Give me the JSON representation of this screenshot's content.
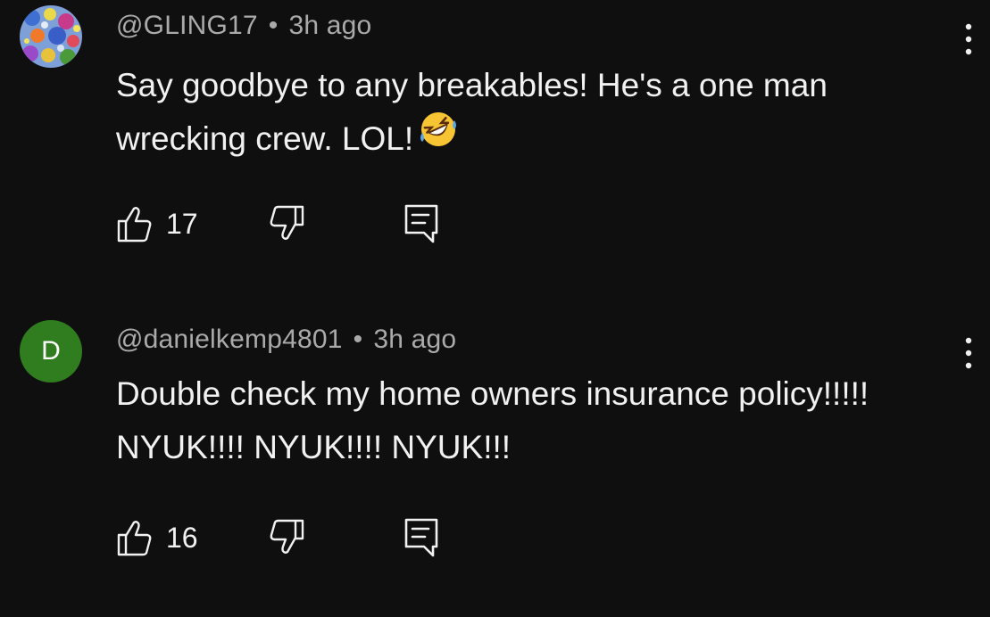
{
  "comments": [
    {
      "author": "@GLING17",
      "separator": "•",
      "time": "3h ago",
      "text": "Say goodbye to any breakables! He's a one man wrecking crew. LOL!",
      "emoji": "rolling-on-the-floor-laughing",
      "likes": "17",
      "avatar": "flower-photo"
    },
    {
      "author": "@danielkemp4801",
      "separator": "•",
      "time": "3h ago",
      "text": "Double check my home owners insurance policy!!!!! NYUK!!!! NYUK!!!! NYUK!!!",
      "likes": "16",
      "avatar_letter": "D",
      "avatar_color": "#2f7d1f"
    }
  ],
  "icons": {
    "like": "thumbs-up-icon",
    "dislike": "thumbs-down-icon",
    "reply": "reply-comment-icon",
    "menu": "more-vertical-icon"
  },
  "colors": {
    "background": "#0f0f0f",
    "text": "#f1f1f1",
    "meta": "#aaaaaa"
  }
}
